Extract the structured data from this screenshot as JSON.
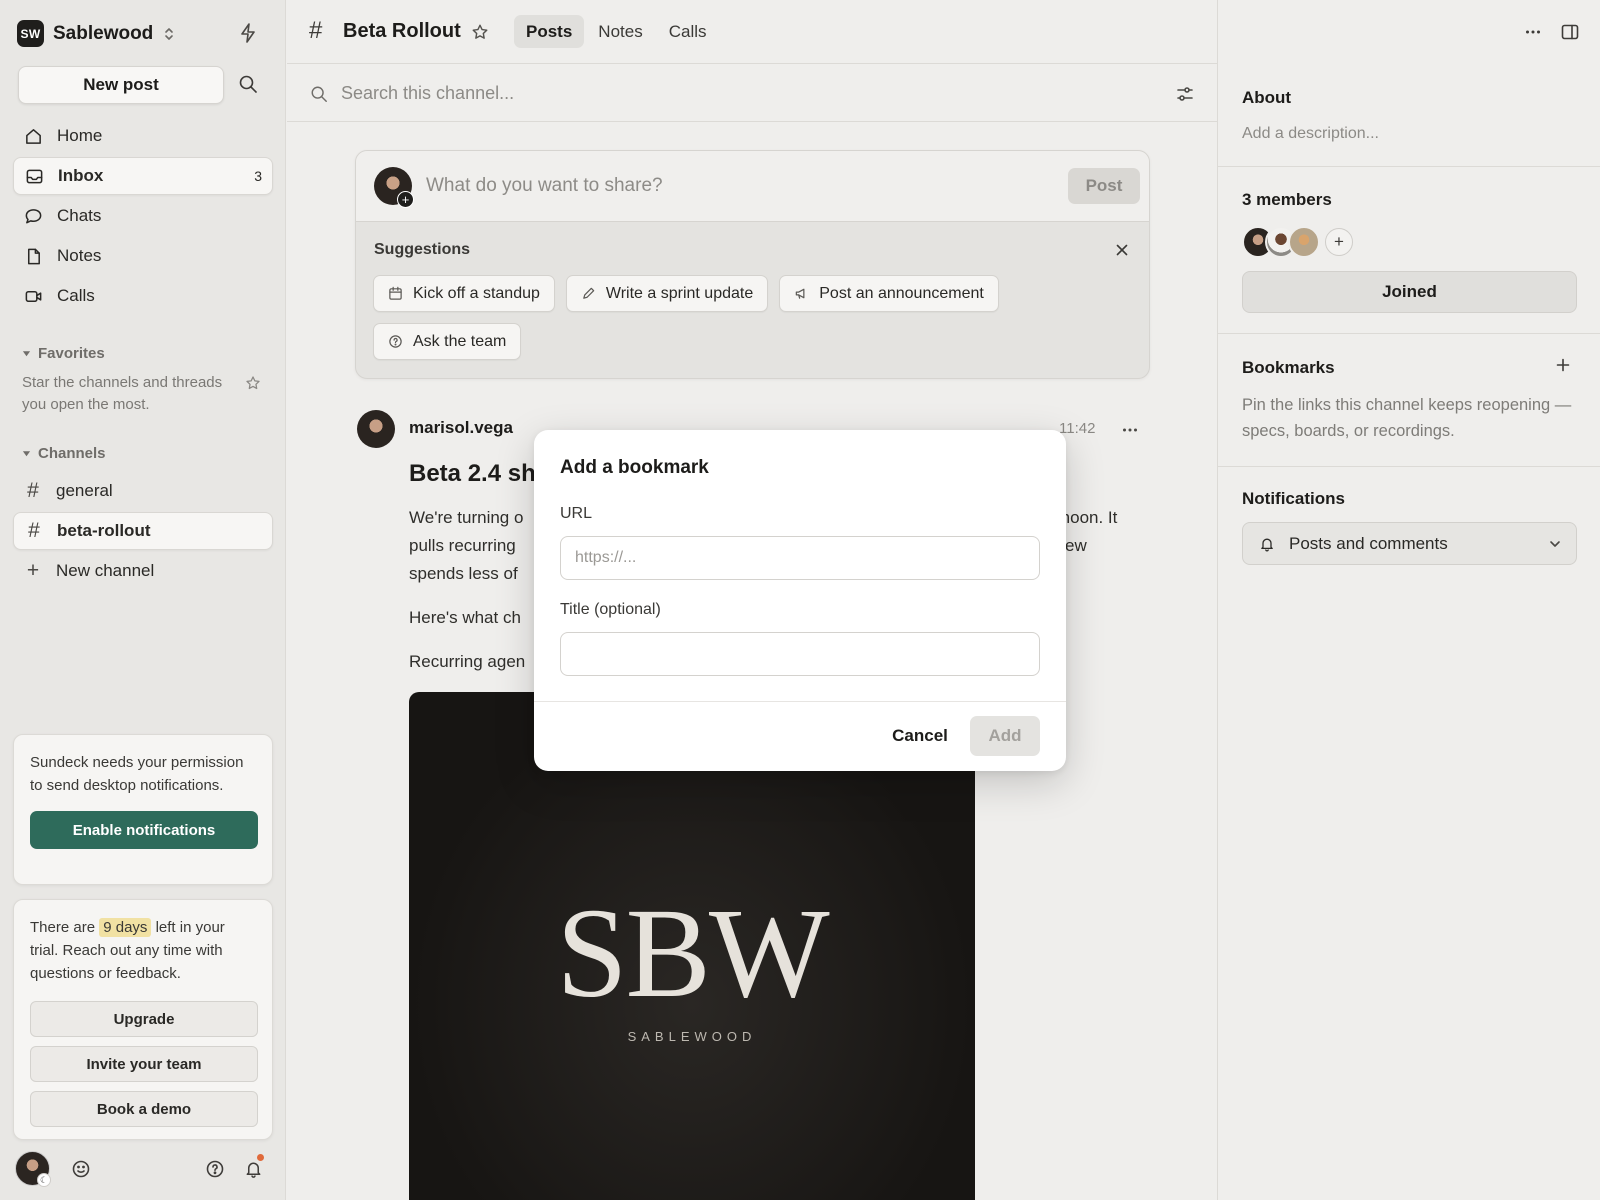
{
  "workspace": {
    "initials": "SW",
    "name": "Sablewood"
  },
  "sidebar": {
    "new_post_label": "New post",
    "nav": [
      {
        "label": "Home",
        "icon": "home-icon"
      },
      {
        "label": "Inbox",
        "icon": "inbox-icon",
        "count": "3",
        "active": true
      },
      {
        "label": "Chats",
        "icon": "chat-icon"
      },
      {
        "label": "Notes",
        "icon": "note-icon"
      },
      {
        "label": "Calls",
        "icon": "video-icon"
      }
    ],
    "favorites": {
      "heading": "Favorites",
      "empty_text": "Star the channels and threads you open the most."
    },
    "channels": {
      "heading": "Channels",
      "items": [
        {
          "label": "general",
          "active": false
        },
        {
          "label": "beta-rollout",
          "active": true
        }
      ],
      "new_channel_label": "New channel"
    },
    "notif_card": {
      "text": "Sundeck needs your permission to send desktop notifications.",
      "button": "Enable notifications"
    },
    "trial_card": {
      "text_before": "There are",
      "highlight": "9 days",
      "text_after": "left in your trial. Reach out any time with questions or feedback.",
      "buttons": [
        "Upgrade",
        "Invite your team",
        "Book a demo"
      ]
    }
  },
  "channel": {
    "title": "Beta Rollout",
    "tabs": [
      {
        "label": "Posts",
        "active": true
      },
      {
        "label": "Notes",
        "active": false
      },
      {
        "label": "Calls",
        "active": false
      }
    ],
    "search_placeholder": "Search this channel..."
  },
  "composer": {
    "placeholder": "What do you want to share?",
    "post_label": "Post",
    "suggestions_title": "Suggestions",
    "suggestions": [
      {
        "label": "Kick off a standup",
        "icon": "calendar-icon"
      },
      {
        "label": "Write a sprint update",
        "icon": "pencil-icon"
      },
      {
        "label": "Post an announcement",
        "icon": "megaphone-icon"
      },
      {
        "label": "Ask the team",
        "icon": "question-icon"
      }
    ]
  },
  "post": {
    "author": "marisol.vega",
    "time": "11:42",
    "title": "Beta 2.4 shi",
    "paragraphs": [
      {
        "left": "We're turning o",
        "right": "rnoon. It"
      },
      {
        "left": "pulls recurring",
        "right": "ew"
      },
      {
        "left": "spends less of",
        "right": ""
      }
    ],
    "line2": "Here's what ch",
    "line3": "Recurring agen",
    "image": {
      "logo": "SBW",
      "wordmark": "SABLEWOOD"
    }
  },
  "right_panel": {
    "about_heading": "About",
    "about_placeholder": "Add a description...",
    "members_heading": "3 members",
    "joined_label": "Joined",
    "bookmarks_heading": "Bookmarks",
    "bookmarks_text": "Pin the links this channel keeps reopening — specs, boards, or recordings.",
    "notifications_heading": "Notifications",
    "notifications_value": "Posts and comments"
  },
  "dialog": {
    "title": "Add a bookmark",
    "url_label": "URL",
    "url_placeholder": "https://...",
    "title_label": "Title (optional)",
    "cancel_label": "Cancel",
    "add_label": "Add"
  },
  "colors": {
    "accent_green": "#2e6b5b",
    "badge_dot": "#e06a3b",
    "highlight": "#f1e1a3"
  }
}
